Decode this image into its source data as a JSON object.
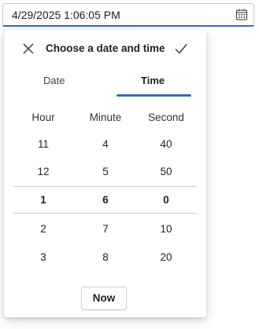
{
  "input": {
    "value": "4/29/2025 1:06:05 PM"
  },
  "popup": {
    "title": "Choose a date and time",
    "tabs": [
      {
        "label": "Date",
        "selected": false
      },
      {
        "label": "Time",
        "selected": true
      }
    ],
    "columns": [
      "Hour",
      "Minute",
      "Second"
    ],
    "hours": [
      "11",
      "12",
      "1",
      "2",
      "3"
    ],
    "minutes": [
      "4",
      "5",
      "6",
      "7",
      "8"
    ],
    "seconds": [
      "40",
      "50",
      "0",
      "10",
      "20"
    ],
    "now_label": "Now"
  },
  "colors": {
    "accent": "#2f6fbf"
  }
}
